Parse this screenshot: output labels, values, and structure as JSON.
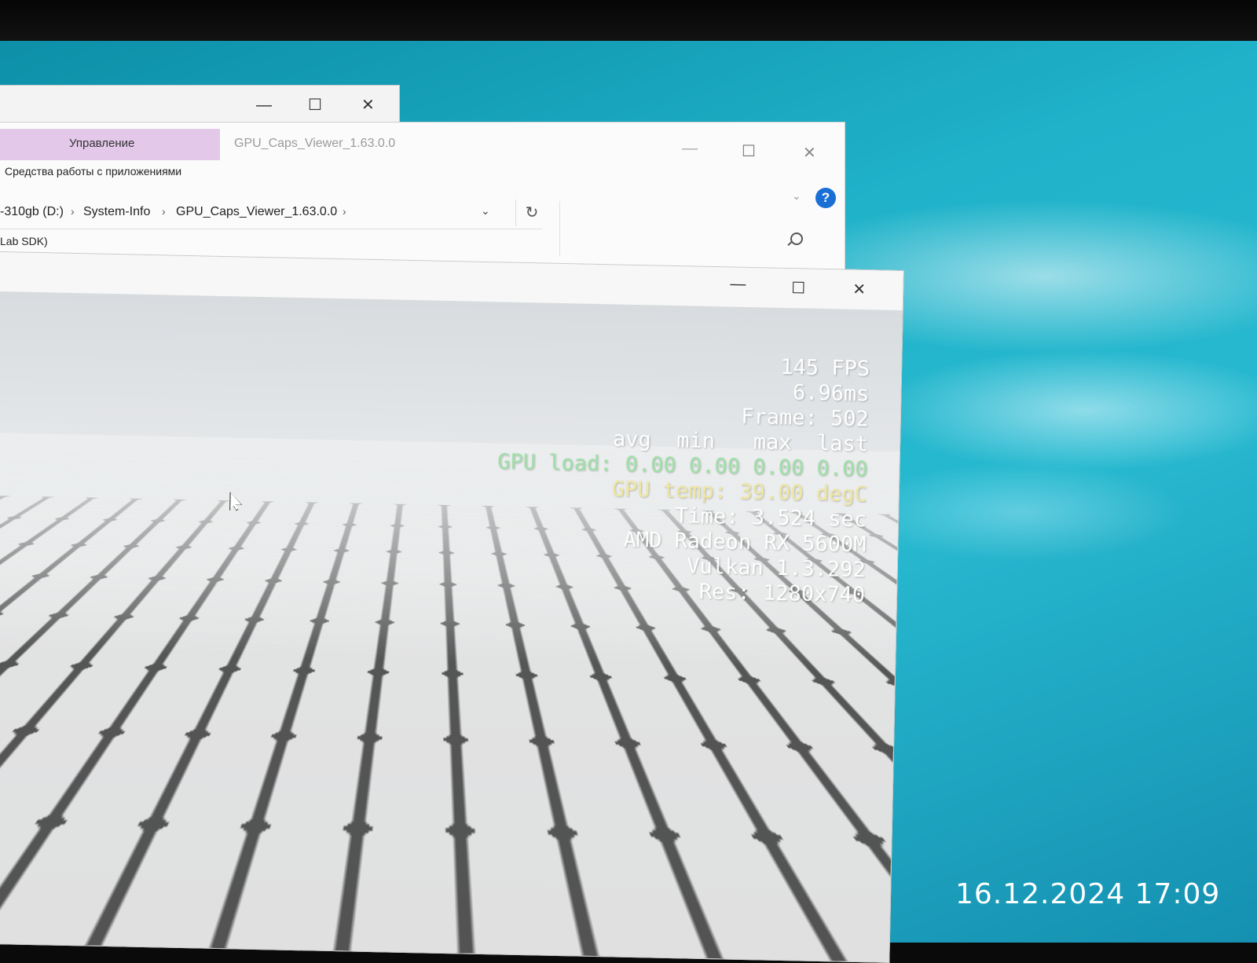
{
  "back_window": {
    "controls": {
      "minimize": "—",
      "maximize": "☐",
      "close": "✕"
    }
  },
  "explorer": {
    "ribbon_manage_label": "Управление",
    "ribbon_manage_sub": "Средства работы с приложениями",
    "title": "GPU_Caps_Viewer_1.63.0.0",
    "controls": {
      "minimize": "—",
      "maximize": "☐",
      "close": "✕"
    },
    "breadcrumb": [
      "-310gb (D:)",
      "System-Info",
      "GPU_Caps_Viewer_1.63.0.0"
    ],
    "breadcrumb_sep": "›",
    "dropdown_glyph": "⌄",
    "refresh_glyph": "↻",
    "help_glyph": "?",
    "ribbon_chevron": "⌄",
    "sidebar_text": "Lab SDK)"
  },
  "demo_window": {
    "controls": {
      "minimize": "—",
      "maximize": "☐",
      "close": "✕"
    },
    "overlay": {
      "fps": "145 FPS",
      "frametime": "6.96ms",
      "frame": "Frame: 502",
      "header": "avg  min   max  last",
      "gpu_load": "GPU load: 0.00 0.00 0.00 0.00",
      "gpu_temp": "GPU temp: 39.00 degC",
      "time": "Time: 3.524 sec",
      "gpu_name": "AMD Radeon RX 5600M",
      "api": "Vulkan 1.3.292",
      "resolution": "Res: 1280x740"
    }
  },
  "photo_timestamp": "16.12.2024 17:09",
  "colors": {
    "manage_tab": "#e3c8ea",
    "help": "#1a6fd6",
    "wallpaper": "#1fb2c9",
    "overlay_green": "#9fe0a8",
    "overlay_yellow": "#f0e7a0"
  }
}
